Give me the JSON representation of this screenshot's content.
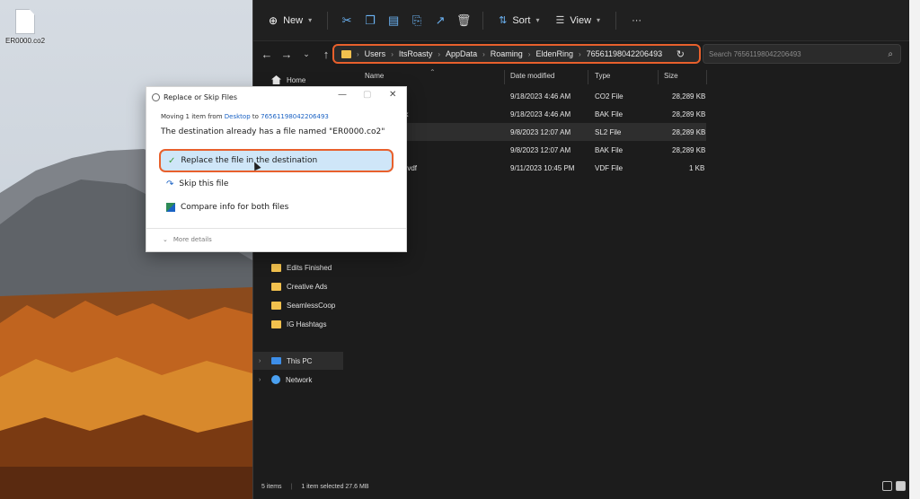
{
  "desktop": {
    "file_label": "ER0000.co2"
  },
  "explorer": {
    "toolbar": {
      "new_label": "New",
      "sort_label": "Sort",
      "view_label": "View",
      "more_label": "···"
    },
    "breadcrumb": [
      "Users",
      "ItsRoasty",
      "AppData",
      "Roaming",
      "EldenRing",
      "76561198042206493"
    ],
    "search_placeholder": "Search 76561198042206493",
    "sidebar": {
      "home": "Home",
      "folders": [
        "Edits Finished",
        "Creative Ads",
        "SeamlessCoop",
        "IG Hashtags"
      ],
      "this_pc": "This PC",
      "network": "Network"
    },
    "columns": {
      "name": "Name",
      "date": "Date modified",
      "type": "Type",
      "size": "Size"
    },
    "rows": [
      {
        "name": "",
        "date": "9/18/2023 4:46 AM",
        "type": "CO2 File",
        "size": "28,289 KB"
      },
      {
        "name": "ak",
        "date": "9/18/2023 4:46 AM",
        "type": "BAK File",
        "size": "28,289 KB"
      },
      {
        "name": "",
        "date": "9/8/2023 12:07 AM",
        "type": "SL2 File",
        "size": "28,289 KB"
      },
      {
        "name": "k",
        "date": "9/8/2023 12:07 AM",
        "type": "BAK File",
        "size": "28,289 KB"
      },
      {
        "name": "loud.vdf",
        "date": "9/11/2023 10:45 PM",
        "type": "VDF File",
        "size": "1 KB"
      }
    ],
    "status": {
      "count": "5 items",
      "selected": "1 item selected  27.6 MB"
    }
  },
  "dialog": {
    "title": "Replace or Skip Files",
    "moving_prefix": "Moving 1 item from",
    "moving_from": "Desktop",
    "moving_to_word": "to",
    "moving_to": "76561198042206493",
    "destination_msg": "The destination already has a file named \"ER0000.co2\"",
    "options": {
      "replace": "Replace the file in the destination",
      "skip": "Skip this file",
      "compare": "Compare info for both files"
    },
    "more_details": "More details"
  },
  "colors": {
    "highlight_outline": "#e8602c",
    "explorer_bg": "#1c1c1c",
    "selected_option_bg": "#cfe6f8",
    "link_blue": "#1a62c4"
  }
}
